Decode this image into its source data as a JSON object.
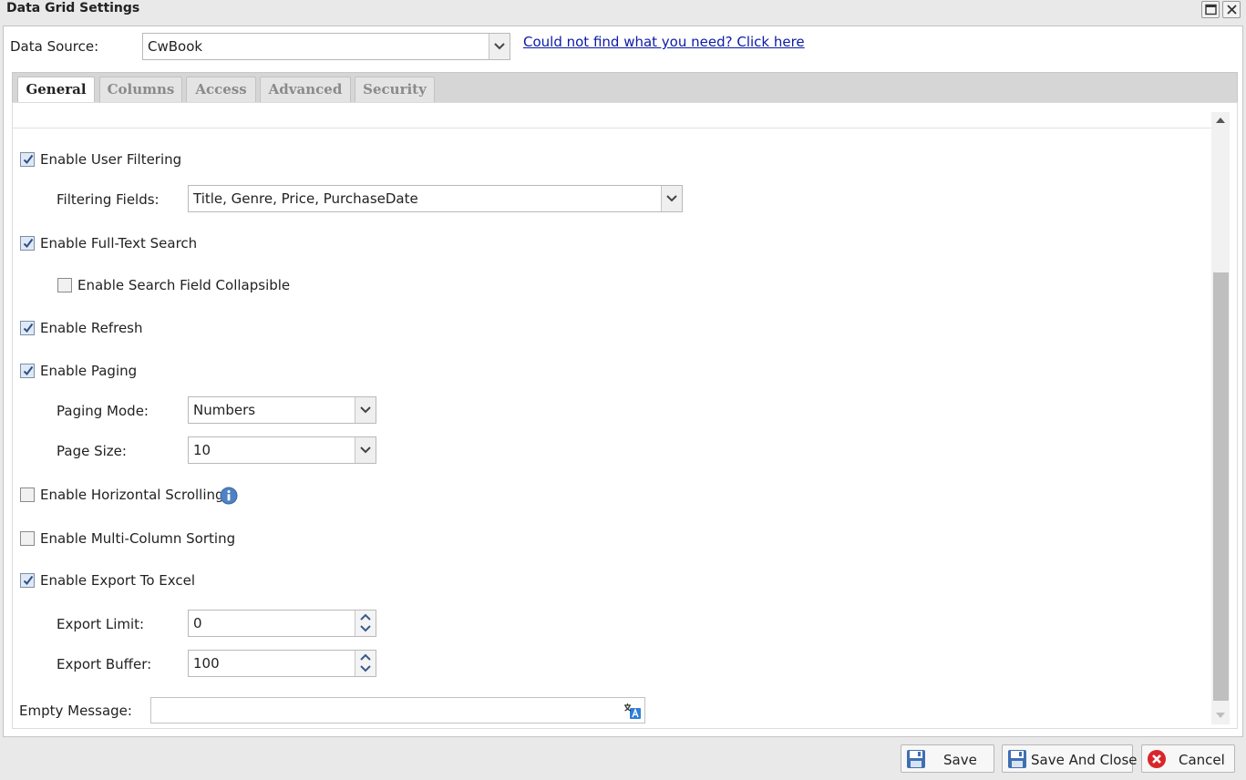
{
  "window": {
    "title": "Data Grid Settings"
  },
  "data_source": {
    "label": "Data Source:",
    "value": "CwBook",
    "help_link": "Could not find what you need? Click here"
  },
  "tabs": [
    {
      "label": "General",
      "active": true
    },
    {
      "label": "Columns",
      "active": false
    },
    {
      "label": "Access",
      "active": false
    },
    {
      "label": "Advanced",
      "active": false
    },
    {
      "label": "Security",
      "active": false
    }
  ],
  "general": {
    "user_filtering": {
      "label": "Enable User Filtering",
      "checked": true
    },
    "filtering_fields": {
      "label": "Filtering Fields:",
      "value": "Title, Genre, Price, PurchaseDate"
    },
    "full_text_search": {
      "label": "Enable Full-Text Search",
      "checked": true
    },
    "search_collapsible": {
      "label": "Enable Search Field Collapsible",
      "checked": false
    },
    "refresh": {
      "label": "Enable Refresh",
      "checked": true
    },
    "paging": {
      "label": "Enable Paging",
      "checked": true
    },
    "paging_mode": {
      "label": "Paging Mode:",
      "value": "Numbers"
    },
    "page_size": {
      "label": "Page Size:",
      "value": "10"
    },
    "horizontal_scrolling": {
      "label": "Enable Horizontal Scrolling",
      "checked": false
    },
    "multi_column_sorting": {
      "label": "Enable Multi-Column Sorting",
      "checked": false
    },
    "export_excel": {
      "label": "Enable Export To Excel",
      "checked": true
    },
    "export_limit": {
      "label": "Export Limit:",
      "value": "0"
    },
    "export_buffer": {
      "label": "Export Buffer:",
      "value": "100"
    },
    "empty_message": {
      "label": "Empty Message:",
      "value": ""
    }
  },
  "footer": {
    "save": "Save",
    "save_close": "Save And Close",
    "cancel": "Cancel"
  },
  "colors": {
    "link": "#0b1aa8",
    "info_icon": "#4f82c3",
    "cancel_icon": "#d8262a",
    "save_icon": "#3f6fb3"
  },
  "icons": [
    "maximize-icon",
    "close-icon",
    "chevron-down-icon",
    "checkmark-icon",
    "info-icon",
    "translate-icon",
    "save-icon",
    "cancel-icon"
  ]
}
